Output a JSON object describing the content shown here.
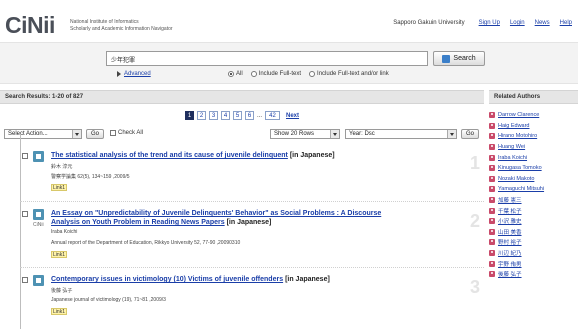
{
  "header": {
    "logo": "CiNii",
    "org_line1": "National Institute of Informatics",
    "org_line2": "Scholarly and Academic Information Navigator",
    "institution": "Sapporo Gakuin University",
    "nav": [
      "Sign Up",
      "Login",
      "News",
      "Help"
    ]
  },
  "search": {
    "query": "少年犯罪",
    "button_label": "Search",
    "advanced_label": "Advanced",
    "scope_options": [
      "All",
      "Include Full-text",
      "Include Full-text and/or link"
    ],
    "scope_selected": "All"
  },
  "results_summary": "Search Results: 1-20 of 827",
  "related_header": "Related Authors",
  "pagination": {
    "pages": [
      "1",
      "2",
      "3",
      "4",
      "5",
      "6",
      "...",
      "42"
    ],
    "current": "1",
    "next_label": "Next"
  },
  "toolbar": {
    "select_action": "Select Action...",
    "go1": "Go",
    "check_all": "Check All",
    "rows_select": "Show 20 Rows",
    "order_select": "Year: Dsc",
    "go2": "Go"
  },
  "results": [
    {
      "num": "1",
      "title": "The statistical analysis of the trend and its cause of juvenile delinquent",
      "lang": "[in Japanese]",
      "author": "鈴木 淳元",
      "source": "警察学論集 62(5), 134~159 ,2009/5",
      "link": "Link1"
    },
    {
      "num": "2",
      "title_line1": "An Essay on \"Unpredictability of Juvenile Delinquents' Behavior\" as Social Problems : A Discourse",
      "title_line2": "Analysis on Youth Problem in Reading News Papers",
      "lang": "[in Japanese]",
      "tag": "CiNii",
      "author": "Iraba Koichi",
      "source": "Annual report of the Department of Education, Rikkyo University 52, 77-90 ,20090310",
      "link": "Link1"
    },
    {
      "num": "3",
      "title": "Contemporary issues in victimology (10) Victims of juvenile offenders",
      "lang": "[in Japanese]",
      "author": "後藤 弘子",
      "source": "Japanese journal of victimology (19), 71~81 ,2009/3",
      "link": "Link1"
    }
  ],
  "authors": [
    "Darrow Clarence",
    "Haig Edward",
    "Hirano Motohiro",
    "Huang Wei",
    "Iraba Koichi",
    "Kinugasa Tomoko",
    "Nozaki Makoto",
    "Yamaguchi Mitsuhi",
    "加藤 憲三",
    "千葉 松子",
    "小沢 雅史",
    "山田 美香",
    "野村 裕子",
    "川辺 紀乃",
    "宇野 侑男",
    "後藤 弘子"
  ],
  "colors": {
    "link": "#1a3ea8",
    "current_page": "#1f2f5e",
    "record_icon": "#4e92b3",
    "author_icon": "#c94a6a",
    "link_badge": "#fff3a8"
  }
}
